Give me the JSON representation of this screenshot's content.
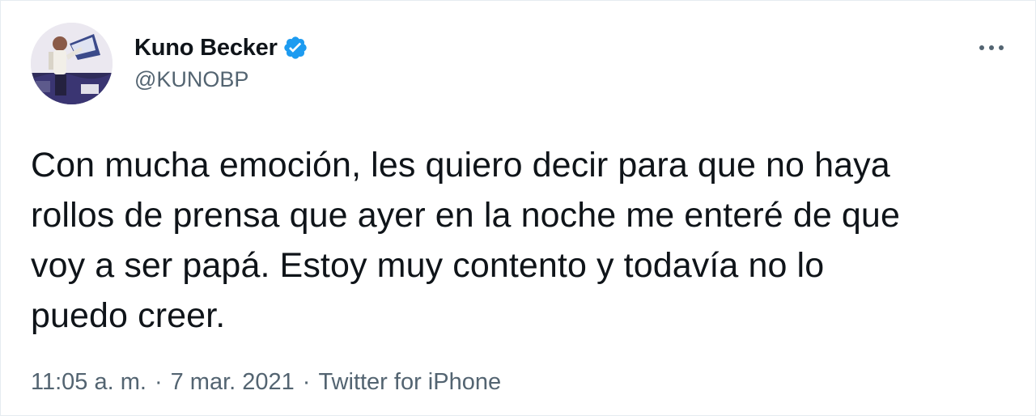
{
  "author": {
    "display_name": "Kuno Becker",
    "handle": "@KUNOBP",
    "verified": true,
    "avatar_icon": "profile-photo",
    "verified_icon": "verified-badge-icon"
  },
  "tweet": {
    "text": "Con mucha emoción, les quiero decir para que no haya\nrollos de prensa que ayer en la noche me enteré de que\nvoy a ser papá. Estoy muy contento y todavía no lo\npuedo creer."
  },
  "meta": {
    "time": "11:05 a. m.",
    "separator": "·",
    "date": "7 mar. 2021",
    "source": "Twitter for iPhone"
  },
  "more_menu_icon": "more-dots-icon",
  "colors": {
    "verified": "#1d9bf0",
    "text_primary": "#0f1419",
    "text_secondary": "#536471",
    "border": "#e6ecf0"
  }
}
